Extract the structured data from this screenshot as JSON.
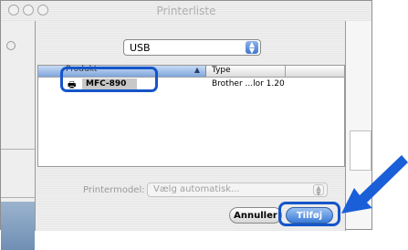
{
  "window": {
    "title": "Printerliste"
  },
  "sheet": {
    "connection_popup": {
      "selected": "USB"
    },
    "table": {
      "columns": [
        "Produkt",
        "Type"
      ],
      "rows": [
        {
          "product": "MFC-890",
          "type": "Brother ...lor 1.20"
        }
      ]
    },
    "printer_model": {
      "label": "Printermodel:",
      "selected": "Vælg automatisk..."
    },
    "buttons": {
      "cancel": "Annuller",
      "add": "Tilføj"
    }
  },
  "colors": {
    "highlight": "#1655c9",
    "arrow": "#1a5fd8",
    "primary_button": "#3a7ad6"
  },
  "icons": {
    "printer_row": "printer-icon",
    "pointer": "arrow-pointer-icon"
  }
}
